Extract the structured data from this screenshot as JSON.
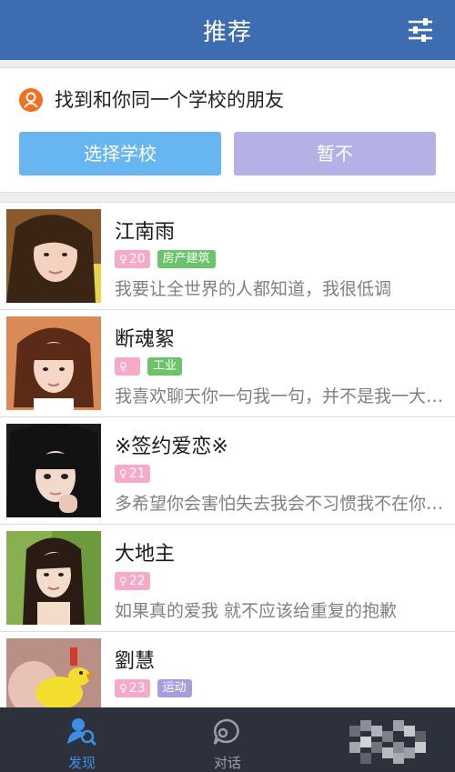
{
  "header": {
    "title": "推荐",
    "filter_icon": "sliders-icon"
  },
  "school_prompt": {
    "text": "找到和你同一个学校的朋友",
    "select_button": "选择学校",
    "skip_button": "暂不",
    "icon": "person-circle-icon"
  },
  "users": [
    {
      "name": "江南雨",
      "age": "20",
      "tag": "房产建筑",
      "tag_color": "#6cc36c",
      "bio": "我要让全世界的人都知道，我很低调"
    },
    {
      "name": "断魂絮",
      "age": "",
      "tag": "工业",
      "tag_color": "#6cc36c",
      "bio": "我喜欢聊天你一句我一句，并不是我一大段你一句"
    },
    {
      "name": "※签约爱恋※",
      "age": "21",
      "tag": "",
      "tag_color": "",
      "bio": "多希望你会害怕失去我会不习惯我不在你身边"
    },
    {
      "name": "大地主",
      "age": "22",
      "tag": "",
      "tag_color": "",
      "bio": "如果真的爱我 就不应该给重复的抱歉"
    },
    {
      "name": "劉慧",
      "age": "23",
      "tag": "运动",
      "tag_color": "#a99ce0",
      "bio": ""
    }
  ],
  "bottom_nav": {
    "discover": "发现",
    "chat": "对话"
  },
  "colors": {
    "header_bg": "#3d6db0",
    "select_button": "#67b6f2",
    "skip_button": "#b4b1e6",
    "age_tag": "#f6a9c9",
    "nav_bg": "#2c313b",
    "nav_active": "#3d8fe6"
  }
}
